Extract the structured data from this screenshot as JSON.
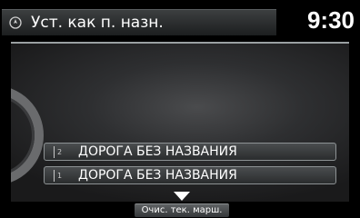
{
  "header": {
    "title": "Уст. как п. назн.",
    "clock": "9:30",
    "nav_icon": "compass-icon"
  },
  "routes": [
    {
      "number": "2",
      "label": "ДОРОГА БЕЗ НАЗВАНИЯ"
    },
    {
      "number": "1",
      "label": "ДОРОГА БЕЗ НАЗВАНИЯ"
    }
  ],
  "footer": {
    "down_icon": "chevron-down-icon",
    "clear_route_label": "Очис. тек. марш."
  },
  "colors": {
    "background": "#000000",
    "title_bar": "#2e3132",
    "route_border": "#8d9294"
  }
}
